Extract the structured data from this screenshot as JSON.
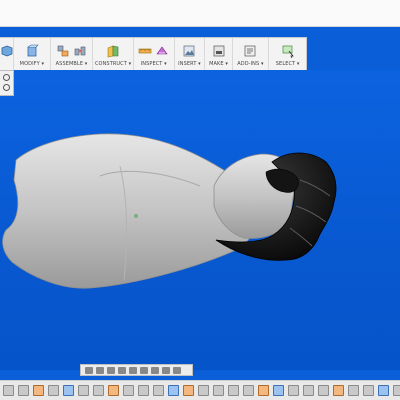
{
  "toolbar": {
    "groups": [
      {
        "label": "MODIFY ▾"
      },
      {
        "label": "ASSEMBLE ▾"
      },
      {
        "label": "CONSTRUCT ▾"
      },
      {
        "label": "INSPECT ▾"
      },
      {
        "label": "INSERT ▾"
      },
      {
        "label": "MAKE ▾"
      },
      {
        "label": "ADD-INS ▾"
      },
      {
        "label": "SELECT ▾"
      }
    ]
  },
  "colors": {
    "viewport_background": "#0a5fd8",
    "arm_model": "#c9c9c9",
    "hand_model": "#0b0b0b"
  }
}
